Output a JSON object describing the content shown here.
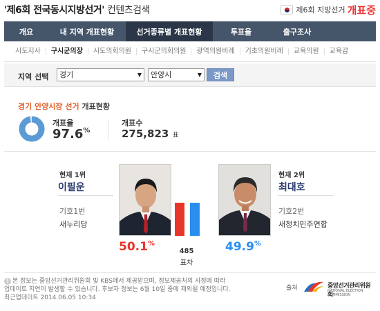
{
  "header": {
    "title": "'제6회 전국동시지방선거'",
    "subtitle": " 컨텐츠검색",
    "badge_prefix": "제6회 지방선거",
    "badge_status": "개표중"
  },
  "nav": {
    "tabs": [
      {
        "label": "개요",
        "active": false
      },
      {
        "label": "내 지역 개표현황",
        "active": false
      },
      {
        "label": "선거종류별 개표현황",
        "active": true
      },
      {
        "label": "투표율",
        "active": false
      },
      {
        "label": "출구조사",
        "active": false
      }
    ]
  },
  "subnav": {
    "items": [
      {
        "label": "시도지사",
        "active": false
      },
      {
        "label": "구시군의장",
        "active": true
      },
      {
        "label": "시도의회의원",
        "active": false
      },
      {
        "label": "구시군의회의원",
        "active": false
      },
      {
        "label": "광역의원비례",
        "active": false
      },
      {
        "label": "기초의원비례",
        "active": false
      },
      {
        "label": "교육의원",
        "active": false
      },
      {
        "label": "교육감",
        "active": false
      }
    ]
  },
  "region": {
    "label": "지역 선택",
    "province": "경기",
    "city": "안양시",
    "search_label": "검색"
  },
  "summary": {
    "heading_highlight": "경기 안양시장 선거",
    "heading_tail": " 개표현황",
    "turnout_label": "개표율",
    "turnout_value": "97.6",
    "turnout_unit": "%",
    "turnout_fraction": 0.976,
    "count_label": "개표수",
    "count_value": "275,823",
    "count_unit": "표"
  },
  "candidates": {
    "first": {
      "rank": "현재 1위",
      "name": "이필운",
      "number": "기호1번",
      "party": "새누리당",
      "pct": "50.1",
      "unit": "%",
      "color": "#e8352a"
    },
    "second": {
      "rank": "현재 2위",
      "name": "최대호",
      "number": "기호2번",
      "party": "새정치민주연합",
      "pct": "49.9",
      "unit": "%",
      "color": "#2a8ef0"
    },
    "gap_value": "485",
    "gap_label": "표차"
  },
  "footer": {
    "note_line1": "본 정보는 중앙선거관리위원회 및 KBS에서 제공받으며, 정보제공처의 사정에 따라",
    "note_line2": "업데이트 지연이 발생할 수 있습니다. 후보자 정보는 6월 10일 중에 제외될 예정입니다.",
    "updated": "최근업데이트 2014.06.05 10:34",
    "source_label": "출처",
    "org_name": "중앙선거관리위원회",
    "org_name_en": "NATIONAL ELECTION COMMISSION"
  }
}
